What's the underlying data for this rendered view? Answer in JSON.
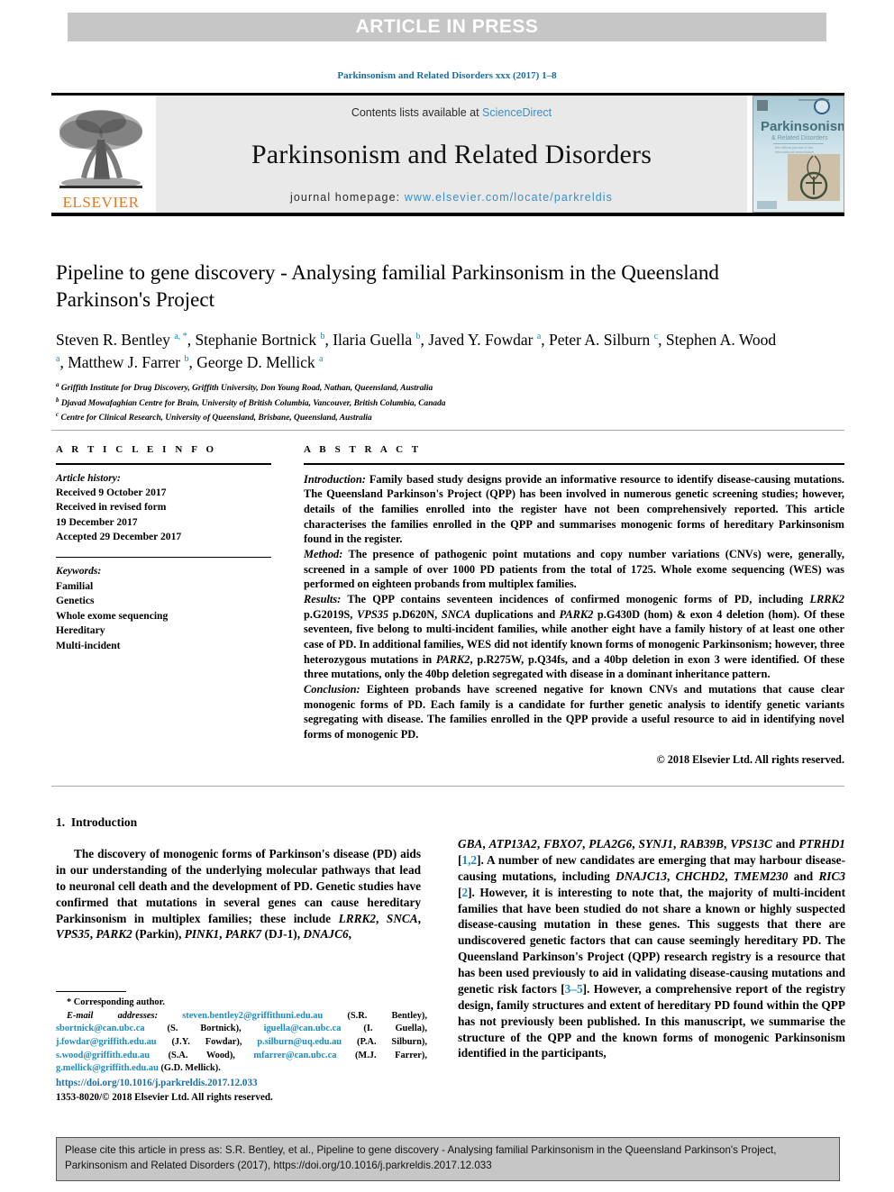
{
  "banner": {
    "text": "ARTICLE IN PRESS"
  },
  "running_head": "Parkinsonism and Related Disorders xxx (2017) 1–8",
  "masthead": {
    "publisher_name": "ELSEVIER",
    "contents_prefix": "Contents lists available at ",
    "contents_link": "ScienceDirect",
    "journal_title": "Parkinsonism and Related Disorders",
    "homepage_prefix": "journal homepage: ",
    "homepage_url": "www.elsevier.com/locate/parkreldis",
    "cover": {
      "title_line1": "Parkinsonism",
      "title_line2": "& Related Disorders"
    },
    "accent_link_color": "#3a8fc4",
    "publisher_color": "#e87722"
  },
  "article": {
    "title": "Pipeline to gene discovery - Analysing familial Parkinsonism in the Queensland Parkinson's Project",
    "authors": [
      {
        "name": "Steven R. Bentley",
        "marks": "a, *"
      },
      {
        "name": "Stephanie Bortnick",
        "marks": "b"
      },
      {
        "name": "Ilaria Guella",
        "marks": "b"
      },
      {
        "name": "Javed Y. Fowdar",
        "marks": "a"
      },
      {
        "name": "Peter A. Silburn",
        "marks": "c"
      },
      {
        "name": "Stephen A. Wood",
        "marks": "a"
      },
      {
        "name": "Matthew J. Farrer",
        "marks": "b"
      },
      {
        "name": "George D. Mellick",
        "marks": "a"
      }
    ],
    "affiliations": [
      {
        "mark": "a",
        "text": "Griffith Institute for Drug Discovery, Griffith University, Don Young Road, Nathan, Queensland, Australia"
      },
      {
        "mark": "b",
        "text": "Djavad Mowafaghian Centre for Brain, University of British Columbia, Vancouver, British Columbia, Canada"
      },
      {
        "mark": "c",
        "text": "Centre for Clinical Research, University of Queensland, Brisbane, Queensland, Australia"
      }
    ]
  },
  "article_info": {
    "heading": "A R T I C L E   I N F O",
    "history_label": "Article history:",
    "history": [
      "Received 9 October 2017",
      "Received in revised form",
      "19 December 2017",
      "Accepted 29 December 2017"
    ],
    "keywords_label": "Keywords:",
    "keywords": [
      "Familial",
      "Genetics",
      "Whole exome sequencing",
      "Hereditary",
      "Multi-incident"
    ]
  },
  "abstract": {
    "heading": "A B S T R A C T",
    "sections": [
      {
        "label": "Introduction:",
        "text": " Family based study designs provide an informative resource to identify disease-causing mutations. The Queensland Parkinson's Project (QPP) has been involved in numerous genetic screening studies; however, details of the families enrolled into the register have not been comprehensively reported. This article characterises the families enrolled in the QPP and summarises monogenic forms of hereditary Parkinsonism found in the register."
      },
      {
        "label": "Method:",
        "text": " The presence of pathogenic point mutations and copy number variations (CNVs) were, generally, screened in a sample of over 1000 PD patients from the total of 1725. Whole exome sequencing (WES) was performed on eighteen probands from multiplex families."
      },
      {
        "label": "Results:",
        "text": " The QPP contains seventeen incidences of confirmed monogenic forms of PD, including LRRK2 p.G2019S, VPS35 p.D620N, SNCA duplications and PARK2 p.G430D (hom) & exon 4 deletion (hom). Of these seventeen, five belong to multi-incident families, while another eight have a family history of at least one other case of PD. In additional families, WES did not identify known forms of monogenic Parkinsonism; however, three heterozygous mutations in PARK2, p.R275W, p.Q34fs, and a 40bp deletion in exon 3 were identified. Of these three mutations, only the 40bp deletion segregated with disease in a dominant inheritance pattern."
      },
      {
        "label": "Conclusion:",
        "text": " Eighteen probands have screened negative for known CNVs and mutations that cause clear monogenic forms of PD. Each family is a candidate for further genetic analysis to identify genetic variants segregating with disease. The families enrolled in the QPP provide a useful resource to aid in identifying novel forms of monogenic PD."
      }
    ],
    "copyright": "© 2018 Elsevier Ltd. All rights reserved."
  },
  "body": {
    "section_number": "1.",
    "section_title": "Introduction",
    "left_paragraph": "The discovery of monogenic forms of Parkinson's disease (PD) aids in our understanding of the underlying molecular pathways that lead to neuronal cell death and the development of PD. Genetic studies have confirmed that mutations in several genes can cause hereditary Parkinsonism in multiplex families; these include LRRK2, SNCA, VPS35, PARK2 (Parkin), PINK1, PARK7 (DJ-1), DNAJC6,",
    "right_paragraph": "GBA, ATP13A2, FBXO7, PLA2G6, SYNJ1, RAB39B, VPS13C and PTRHD1 [1,2]. A number of new candidates are emerging that may harbour disease-causing mutations, including DNAJC13, CHCHD2, TMEM230 and RIC3 [2]. However, it is interesting to note that, the majority of multi-incident families that have been studied do not share a known or highly suspected disease-causing mutation in these genes. This suggests that there are undiscovered genetic factors that can cause seemingly hereditary PD. The Queensland Parkinson's Project (QPP) research registry is a resource that has been used previously to aid in validating disease-causing mutations and genetic risk factors [3–5]. However, a comprehensive report of the registry design, family structures and extent of hereditary PD found within the QPP has not previously been published. In this manuscript, we summarise the structure of the QPP and the known forms of monogenic Parkinsonism identified in the participants,"
  },
  "footnote": {
    "corresponding": "* Corresponding author.",
    "email_label": "E-mail addresses:",
    "emails": [
      {
        "address": "steven.bentley2@griffithuni.edu.au",
        "person": "(S.R. Bentley)"
      },
      {
        "address": "sbortnick@can.ubc.ca",
        "person": "(S. Bortnick)"
      },
      {
        "address": "iguella@can.ubc.ca",
        "person": "(I. Guella)"
      },
      {
        "address": "j.fowdar@griffith.edu.au",
        "person": "(J.Y. Fowdar)"
      },
      {
        "address": "p.silburn@uq.edu.au",
        "person": "(P.A. Silburn)"
      },
      {
        "address": "s.wood@griffith.edu.au",
        "person": "(S.A. Wood)"
      },
      {
        "address": "mfarrer@can.ubc.ca",
        "person": "(M.J. Farrer)"
      },
      {
        "address": "g.mellick@griffith.edu.au",
        "person": "(G.D. Mellick)"
      }
    ],
    "doi_url": "https://doi.org/10.1016/j.parkreldis.2017.12.033",
    "issn_line": "1353-8020/© 2018 Elsevier Ltd. All rights reserved."
  },
  "citation_box": {
    "text": "Please cite this article in press as: S.R. Bentley, et al., Pipeline to gene discovery - Analysing familial Parkinsonism in the Queensland Parkinson's Project, Parkinsonism and Related Disorders (2017), https://doi.org/10.1016/j.parkreldis.2017.12.033"
  }
}
